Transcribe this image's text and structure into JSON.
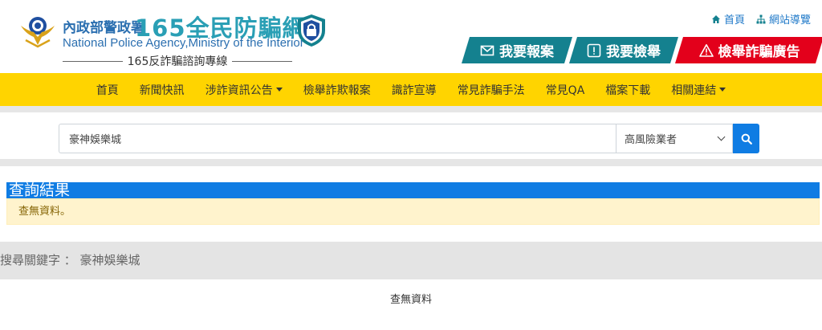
{
  "brand": {
    "agency_zh": "內政部警政署",
    "site_name": "165全民防騙網",
    "agency_en": "National Police Agency,Ministry of the Interior",
    "hotline": "165反詐騙諮詢專線"
  },
  "toplinks": {
    "home": "首頁",
    "sitemap": "網站導覽"
  },
  "actions": {
    "report": "我要報案",
    "tipoff": "我要檢舉",
    "adfraud": "檢舉詐騙廣告"
  },
  "nav": {
    "items": [
      {
        "label": "首頁"
      },
      {
        "label": "新聞快訊"
      },
      {
        "label": "涉詐資訊公告"
      },
      {
        "label": "檢舉詐欺報案"
      },
      {
        "label": "識詐宣導"
      },
      {
        "label": "常見詐騙手法"
      },
      {
        "label": "常見QA"
      },
      {
        "label": "檔案下載"
      },
      {
        "label": "相關連結"
      }
    ]
  },
  "search": {
    "value": "豪神娛樂城",
    "category": "高風險業者"
  },
  "result": {
    "title": "查詢結果",
    "alert": "查無資料。",
    "keyword_label": "搜尋關鍵字 ： 豪神娛樂城",
    "no_data": "查無資料"
  },
  "colors": {
    "nav_bg": "#ffd400",
    "teal": "#14818f",
    "red": "#e3001b",
    "blue": "#0f7ce3",
    "alert_bg": "#fff3cd"
  },
  "icons": [
    "emblem-icon",
    "shield-lock-icon",
    "home-icon",
    "sitemap-icon",
    "envelope-icon",
    "exclamation-box-icon",
    "warning-triangle-icon",
    "caret-down-icon",
    "search-icon"
  ]
}
